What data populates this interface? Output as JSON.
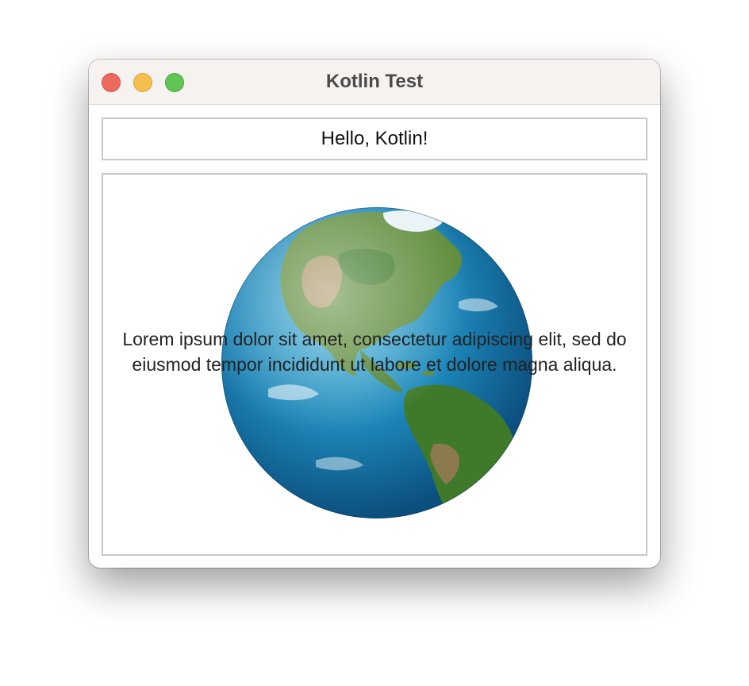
{
  "window": {
    "title": "Kotlin Test"
  },
  "header_label": {
    "text": "Hello, Kotlin!"
  },
  "main_panel": {
    "image_icon": "earth-globe-americas",
    "overlay_text": "Lorem ipsum dolor sit amet, consectetur adipiscing elit, sed do eiusmod tempor incididunt ut labore et dolore magna aliqua."
  },
  "colors": {
    "close": "#ed6a5e",
    "minimize": "#f5bf4f",
    "zoom": "#61c554",
    "border": "#c8c8c8"
  }
}
